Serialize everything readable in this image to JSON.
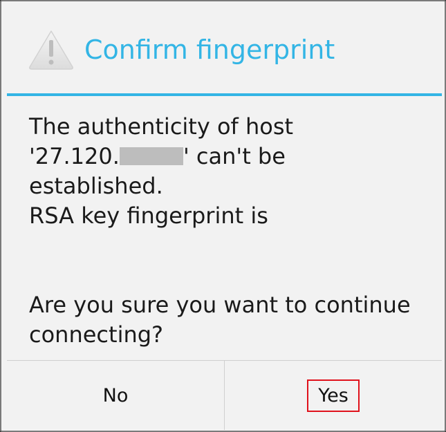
{
  "dialog": {
    "title": "Confirm fingerprint",
    "icon": "warning-icon",
    "accent_color": "#33b5e5",
    "message": {
      "line1": "The authenticity of host",
      "line2_prefix": "'27.120.",
      "line2_suffix": "' can't be",
      "line3": "established.",
      "line4": "RSA key fingerprint is",
      "question_line1": "Are you sure you want to continue",
      "question_line2": "connecting?"
    },
    "buttons": {
      "no_label": "No",
      "yes_label": "Yes"
    },
    "highlight_color": "#e0111b"
  }
}
